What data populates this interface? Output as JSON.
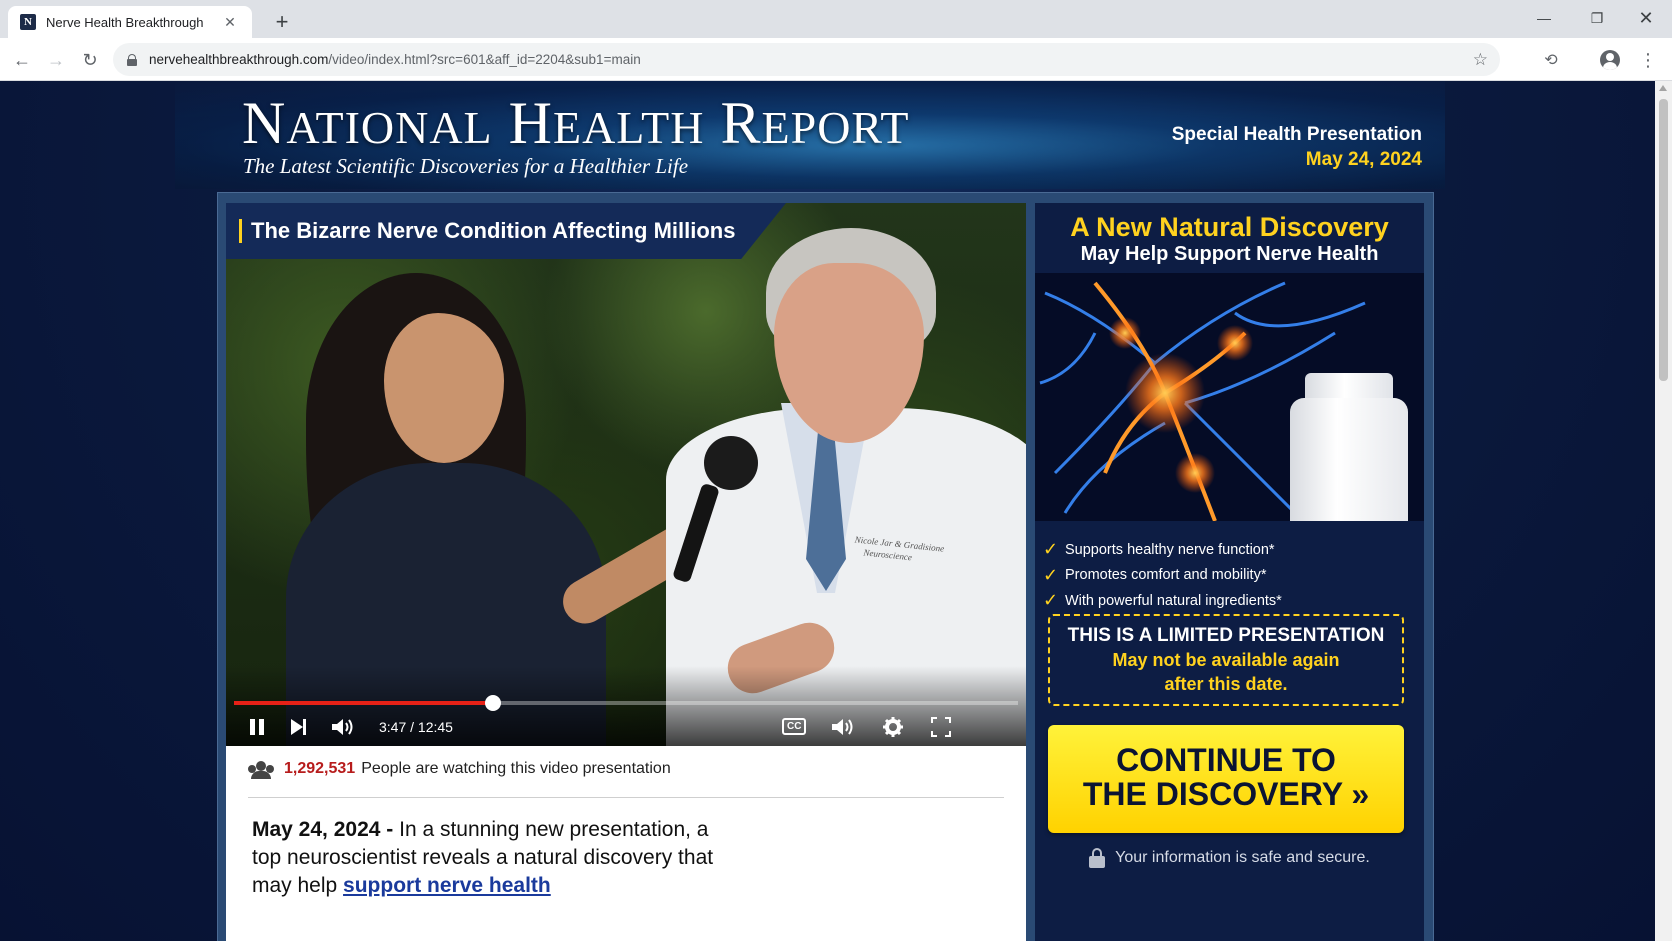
{
  "browser": {
    "tab_title": "Nerve Health Breakthrough",
    "favicon_letter": "N",
    "new_tab": "+",
    "url_host": "nervehealthbreakthrough.com",
    "url_path": "/video/index.html?src=601&aff_id=2204&sub1=main"
  },
  "header": {
    "masthead": {
      "w1_first": "N",
      "w1_rest": "ATIONAL",
      "w2_first": "H",
      "w2_rest": "EALTH",
      "w3_first": "R",
      "w3_rest": "EPORT"
    },
    "tagline": "The Latest Scientific Discoveries for a Healthier Life",
    "special_line1": "Special Health Presentation",
    "special_line2": "May 24, 2024"
  },
  "video": {
    "title": "The Bizarre Nerve Condition Affecting Millions",
    "coat_text_1": "Nicole Jar & Gradisione",
    "coat_text_2": "Neuroscience",
    "time": "3:47 / 12:45",
    "progress": 0.33,
    "cc_label": "CC"
  },
  "below_video": {
    "viewer_count": "1,292,531",
    "viewer_text": "People are watching this video presentation",
    "date": "May 24, 2024",
    "dash": " - ",
    "lead_text": "In a stunning new presentation, a top neuroscientist reveals a natural discovery that may help ",
    "lead_link": "support nerve health"
  },
  "sidebar": {
    "heading": "A New Natural Discovery",
    "subheading": "May Help Support Nerve Health",
    "benefits": [
      "Supports healthy nerve function*",
      "Promotes comfort and mobility*",
      "With powerful natural ingredients*"
    ],
    "limited_title": "THIS IS A LIMITED PRESENTATION",
    "limited_line2": "May not be available again",
    "limited_line3": "after this date.",
    "cta_line1": "CONTINUE TO",
    "cta_line2": "THE DISCOVERY",
    "cta_arrows": "»",
    "secure_text": "Your information is safe and secure."
  },
  "colors": {
    "accent_yellow": "#ffd21f",
    "navy": "#0d1d44",
    "progress_red": "#e62117",
    "viewer_count_red": "#b71c1c",
    "link_blue": "#1a3a9c"
  }
}
